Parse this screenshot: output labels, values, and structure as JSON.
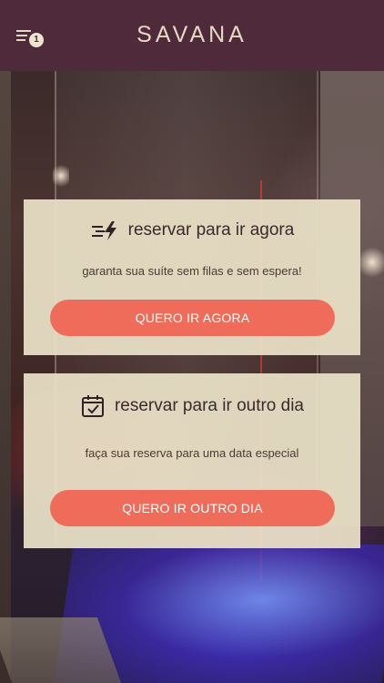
{
  "header": {
    "brand": "SAVANA",
    "menu_icon": "hamburger-menu-icon",
    "notification_count": "1",
    "background_color": "#4f2a3a"
  },
  "cards": {
    "now": {
      "icon": "fast-lightning-icon",
      "title": "reservar para ir agora",
      "subtitle": "garanta sua suíte sem filas e sem espera!",
      "button_label": "QUERO IR AGORA"
    },
    "later": {
      "icon": "calendar-check-icon",
      "title": "reservar para ir outro dia",
      "subtitle": "faça sua reserva para uma data especial",
      "button_label": "QUERO IR OUTRO DIA"
    }
  },
  "colors": {
    "accent": "#f06c5a",
    "card_background": "#ebe2c8",
    "header_background": "#4f2a3a"
  }
}
